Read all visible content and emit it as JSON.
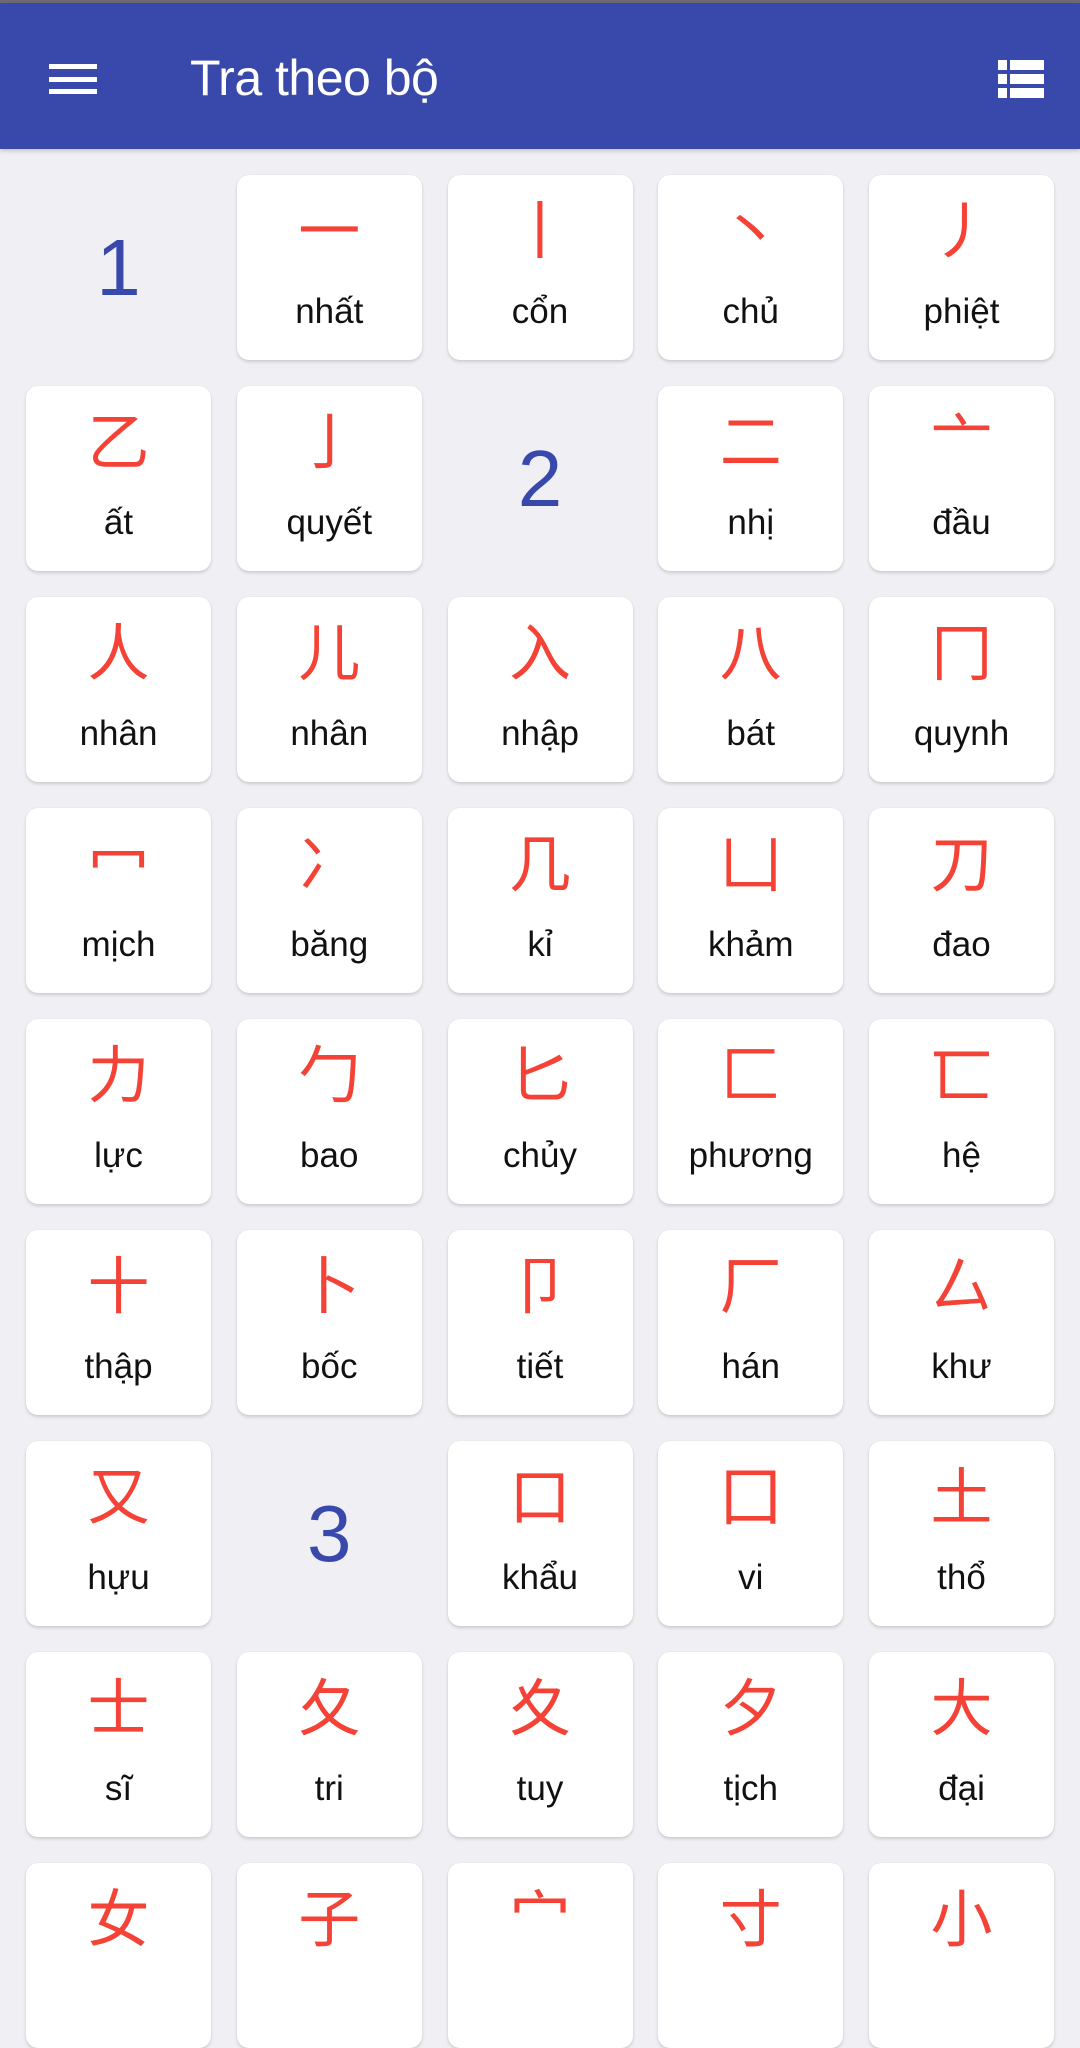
{
  "app_bar": {
    "title": "Tra theo bộ",
    "menu_icon": "hamburger-menu-icon",
    "view_toggle_icon": "list-view-icon"
  },
  "colors": {
    "app_bar": "#3949ab",
    "stroke_header": "#3949ab",
    "radical": "#f44336",
    "background": "#efeff4",
    "card": "#ffffff"
  },
  "grid": {
    "items": [
      {
        "type": "header",
        "strokes": "1"
      },
      {
        "type": "radical",
        "char": "一",
        "name": "nhất"
      },
      {
        "type": "radical",
        "char": "丨",
        "name": "cổn"
      },
      {
        "type": "radical",
        "char": "丶",
        "name": "chủ"
      },
      {
        "type": "radical",
        "char": "丿",
        "name": "phiệt"
      },
      {
        "type": "radical",
        "char": "乙",
        "name": "ất"
      },
      {
        "type": "radical",
        "char": "亅",
        "name": "quyết"
      },
      {
        "type": "header",
        "strokes": "2"
      },
      {
        "type": "radical",
        "char": "二",
        "name": "nhị"
      },
      {
        "type": "radical",
        "char": "亠",
        "name": "đầu"
      },
      {
        "type": "radical",
        "char": "人",
        "name": "nhân"
      },
      {
        "type": "radical",
        "char": "儿",
        "name": "nhân"
      },
      {
        "type": "radical",
        "char": "入",
        "name": "nhập"
      },
      {
        "type": "radical",
        "char": "八",
        "name": "bát"
      },
      {
        "type": "radical",
        "char": "冂",
        "name": "quynh"
      },
      {
        "type": "radical",
        "char": "冖",
        "name": "mịch"
      },
      {
        "type": "radical",
        "char": "冫",
        "name": "băng"
      },
      {
        "type": "radical",
        "char": "几",
        "name": "kỉ"
      },
      {
        "type": "radical",
        "char": "凵",
        "name": "khảm"
      },
      {
        "type": "radical",
        "char": "刀",
        "name": "đao"
      },
      {
        "type": "radical",
        "char": "力",
        "name": "lực"
      },
      {
        "type": "radical",
        "char": "勹",
        "name": "bao"
      },
      {
        "type": "radical",
        "char": "匕",
        "name": "chủy"
      },
      {
        "type": "radical",
        "char": "匚",
        "name": "phương"
      },
      {
        "type": "radical",
        "char": "匸",
        "name": "hệ"
      },
      {
        "type": "radical",
        "char": "十",
        "name": "thập"
      },
      {
        "type": "radical",
        "char": "卜",
        "name": "bốc"
      },
      {
        "type": "radical",
        "char": "卩",
        "name": "tiết"
      },
      {
        "type": "radical",
        "char": "厂",
        "name": "hán"
      },
      {
        "type": "radical",
        "char": "厶",
        "name": "khư"
      },
      {
        "type": "radical",
        "char": "又",
        "name": "hựu"
      },
      {
        "type": "header",
        "strokes": "3"
      },
      {
        "type": "radical",
        "char": "口",
        "name": "khẩu"
      },
      {
        "type": "radical",
        "char": "囗",
        "name": "vi"
      },
      {
        "type": "radical",
        "char": "土",
        "name": "thổ"
      },
      {
        "type": "radical",
        "char": "士",
        "name": "sĩ"
      },
      {
        "type": "radical",
        "char": "夂",
        "name": "tri"
      },
      {
        "type": "radical",
        "char": "夊",
        "name": "tuy"
      },
      {
        "type": "radical",
        "char": "夕",
        "name": "tịch"
      },
      {
        "type": "radical",
        "char": "大",
        "name": "đại"
      },
      {
        "type": "radical",
        "char": "女",
        "name": ""
      },
      {
        "type": "radical",
        "char": "子",
        "name": ""
      },
      {
        "type": "radical",
        "char": "宀",
        "name": ""
      },
      {
        "type": "radical",
        "char": "寸",
        "name": ""
      },
      {
        "type": "radical",
        "char": "小",
        "name": ""
      }
    ]
  }
}
